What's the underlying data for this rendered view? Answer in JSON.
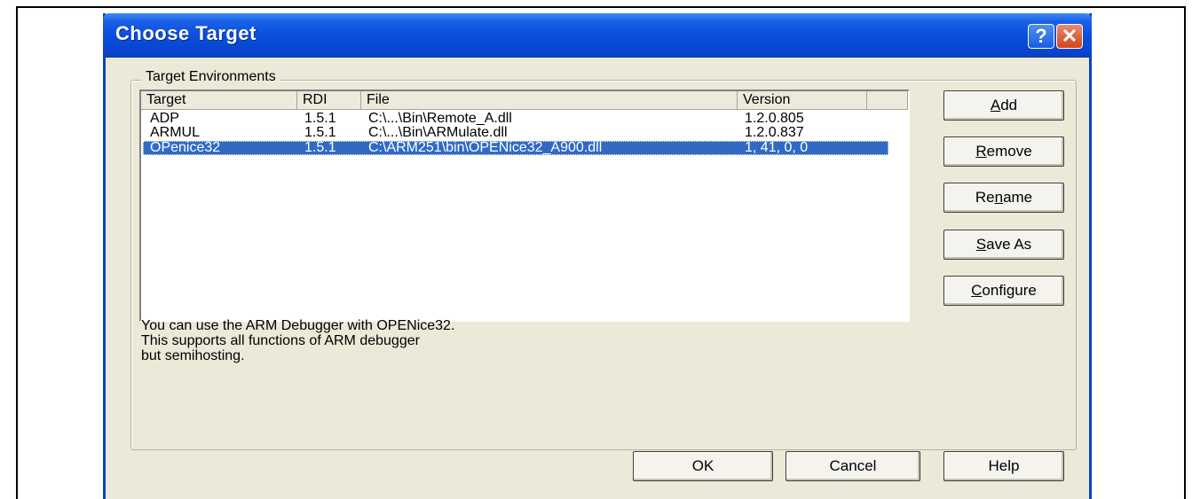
{
  "dialog": {
    "title": "Choose Target",
    "help_icon": "?",
    "close_icon": "✕"
  },
  "group": {
    "label": "Target Environments"
  },
  "list": {
    "columns": [
      "Target",
      "RDI",
      "File",
      "Version"
    ],
    "rows": [
      {
        "target": "ADP",
        "rdi": "1.5.1",
        "file": "C:\\...\\Bin\\Remote_A.dll",
        "version": "1.2.0.805",
        "selected": false
      },
      {
        "target": "ARMUL",
        "rdi": "1.5.1",
        "file": "C:\\...\\Bin\\ARMulate.dll",
        "version": "1.2.0.837",
        "selected": false
      },
      {
        "target": "OPenice32",
        "rdi": "1.5.1",
        "file": "C:\\ARM251\\bin\\OPENice32_A900.dll",
        "version": "1, 41, 0, 0",
        "selected": true
      }
    ]
  },
  "description": {
    "line1": "You can use the ARM Debugger with OPENice32.",
    "line2": "This supports all functions of ARM debugger",
    "line3": "but semihosting."
  },
  "buttons": {
    "add": {
      "pre": "",
      "mnemonic": "A",
      "post": "dd"
    },
    "remove": {
      "pre": "",
      "mnemonic": "R",
      "post": "emove"
    },
    "rename": {
      "pre": "Re",
      "mnemonic": "n",
      "post": "ame"
    },
    "save_as": {
      "pre": "",
      "mnemonic": "S",
      "post": "ave As"
    },
    "configure": {
      "pre": "",
      "mnemonic": "C",
      "post": "onfigure"
    },
    "ok": "OK",
    "cancel": "Cancel",
    "help": "Help"
  },
  "colors": {
    "titlebar": "#0a4fdc",
    "dialog_bg": "#ece9d8",
    "selection": "#316ac5"
  }
}
